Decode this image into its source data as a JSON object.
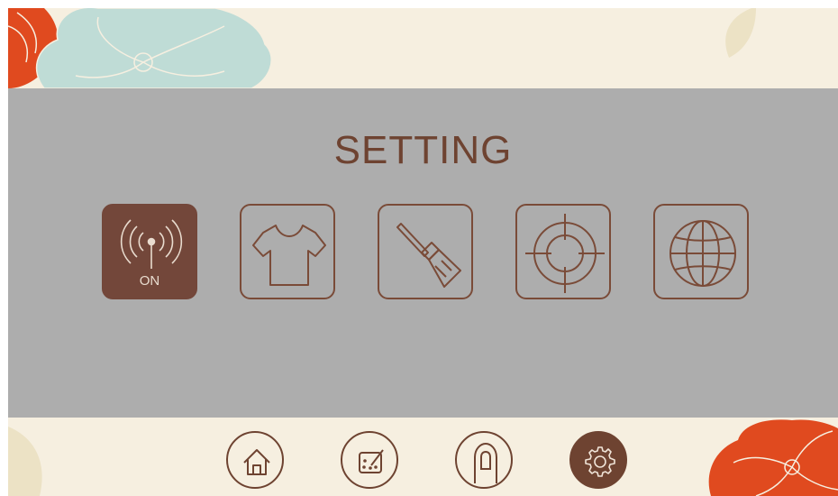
{
  "screen": {
    "title": "SETTING"
  },
  "settings_tiles": [
    {
      "id": "wifi",
      "icon": "wifi-signal-icon",
      "label": "ON",
      "active": true
    },
    {
      "id": "shirt",
      "icon": "t-shirt-icon",
      "active": false
    },
    {
      "id": "brush",
      "icon": "paint-brush-icon",
      "active": false
    },
    {
      "id": "target",
      "icon": "crosshair-icon",
      "active": false
    },
    {
      "id": "globe",
      "icon": "globe-icon",
      "active": false
    }
  ],
  "bottom_nav": [
    {
      "id": "home",
      "icon": "home-icon",
      "active": false
    },
    {
      "id": "palette",
      "icon": "palette-edit-icon",
      "active": false
    },
    {
      "id": "touch",
      "icon": "fingertip-icon",
      "active": false
    },
    {
      "id": "settings",
      "icon": "gear-icon",
      "active": true
    }
  ],
  "colors": {
    "accent_brown": "#6e4331",
    "panel_gray": "#adadad",
    "cream": "#f6efe0",
    "flower_red": "#e04a1f",
    "flower_teal": "#bfdcd6"
  }
}
